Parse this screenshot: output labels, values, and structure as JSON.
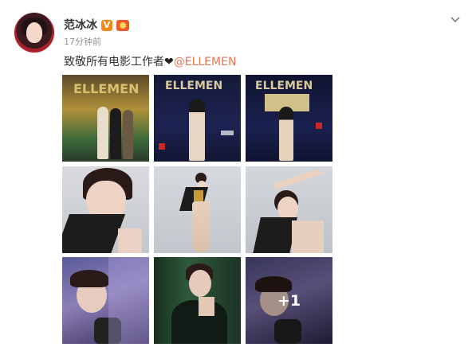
{
  "user": {
    "name": "范冰冰",
    "verified_mark": "V",
    "timestamp": "17分钟前"
  },
  "post": {
    "text": "致敬所有电影工作者",
    "heart": "❤",
    "mention": "@ELLEMEN"
  },
  "images": [
    {
      "scene": "red-carpet-group"
    },
    {
      "scene": "red-carpet-solo"
    },
    {
      "scene": "red-carpet-award"
    },
    {
      "scene": "portrait-black-collar"
    },
    {
      "scene": "full-length-gown"
    },
    {
      "scene": "arm-raised-pose"
    },
    {
      "scene": "purple-drape"
    },
    {
      "scene": "green-curtain"
    },
    {
      "scene": "purple-drape-2",
      "more_count": "+1"
    }
  ],
  "colors": {
    "name": "#333333",
    "timestamp": "#939393",
    "mention": "#eb7350",
    "verified": "#f08b1b"
  }
}
